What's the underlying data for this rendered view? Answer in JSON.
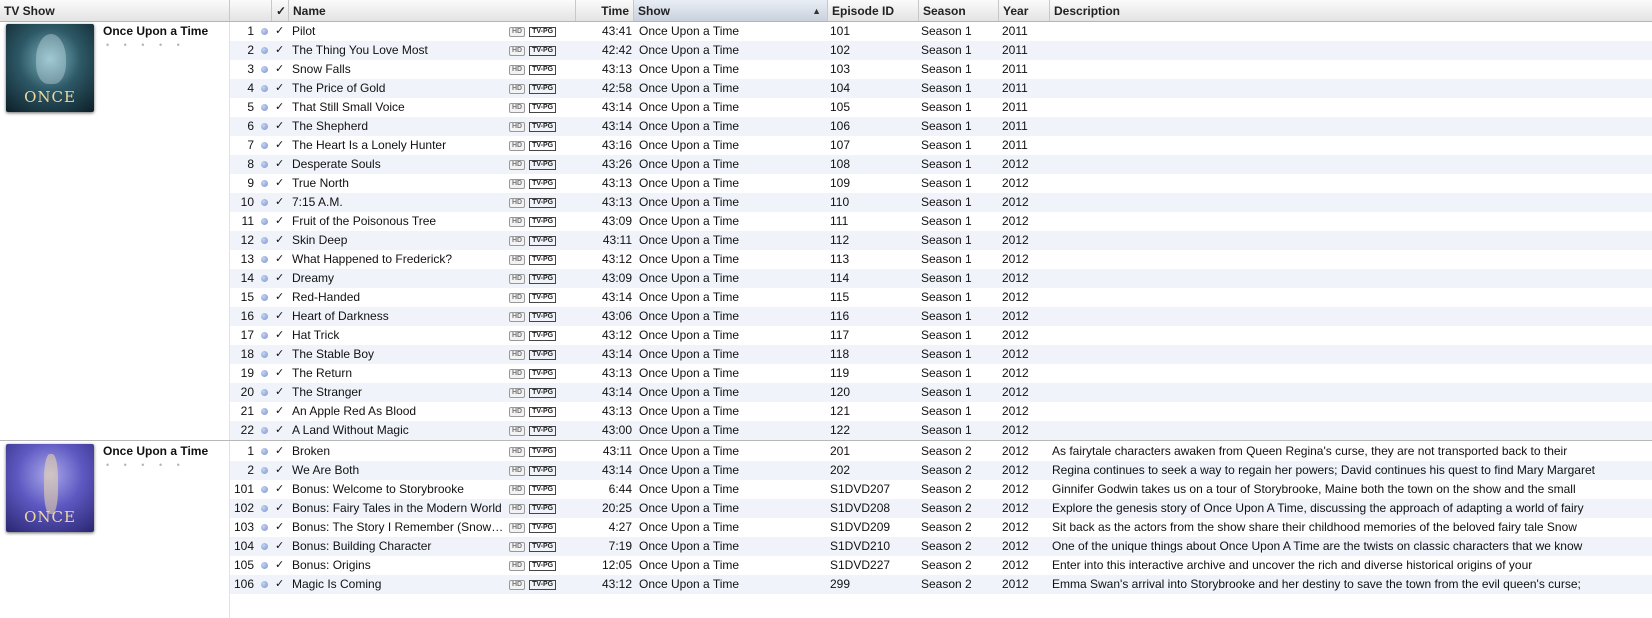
{
  "columns": {
    "tv_show": "TV Show",
    "check": "✓",
    "name": "Name",
    "time": "Time",
    "show": "Show",
    "episode_id": "Episode ID",
    "season": "Season",
    "year": "Year",
    "description": "Description"
  },
  "sort": {
    "column": "Show",
    "direction": "ascending",
    "icon": "sort-ascending-icon"
  },
  "groups": [
    {
      "title": "Once Upon a Time",
      "rating_dots": "• • • • •",
      "artwork_text": "ONCE",
      "rows": [
        {
          "num": "1",
          "name": "Pilot",
          "hd": "HD",
          "rating": "TV-PG",
          "time": "43:41",
          "show": "Once Upon a Time",
          "episode_id": "101",
          "season": "Season 1",
          "year": "2011",
          "description": ""
        },
        {
          "num": "2",
          "name": "The Thing You Love Most",
          "hd": "HD",
          "rating": "TV-PG",
          "time": "42:42",
          "show": "Once Upon a Time",
          "episode_id": "102",
          "season": "Season 1",
          "year": "2011",
          "description": ""
        },
        {
          "num": "3",
          "name": "Snow Falls",
          "hd": "HD",
          "rating": "TV-PG",
          "time": "43:13",
          "show": "Once Upon a Time",
          "episode_id": "103",
          "season": "Season 1",
          "year": "2011",
          "description": ""
        },
        {
          "num": "4",
          "name": "The Price of Gold",
          "hd": "HD",
          "rating": "TV-PG",
          "time": "42:58",
          "show": "Once Upon a Time",
          "episode_id": "104",
          "season": "Season 1",
          "year": "2011",
          "description": ""
        },
        {
          "num": "5",
          "name": "That Still Small Voice",
          "hd": "HD",
          "rating": "TV-PG",
          "time": "43:14",
          "show": "Once Upon a Time",
          "episode_id": "105",
          "season": "Season 1",
          "year": "2011",
          "description": ""
        },
        {
          "num": "6",
          "name": "The Shepherd",
          "hd": "HD",
          "rating": "TV-PG",
          "time": "43:14",
          "show": "Once Upon a Time",
          "episode_id": "106",
          "season": "Season 1",
          "year": "2011",
          "description": ""
        },
        {
          "num": "7",
          "name": "The Heart Is a Lonely Hunter",
          "hd": "HD",
          "rating": "TV-PG",
          "time": "43:16",
          "show": "Once Upon a Time",
          "episode_id": "107",
          "season": "Season 1",
          "year": "2011",
          "description": ""
        },
        {
          "num": "8",
          "name": "Desperate Souls",
          "hd": "HD",
          "rating": "TV-PG",
          "time": "43:26",
          "show": "Once Upon a Time",
          "episode_id": "108",
          "season": "Season 1",
          "year": "2012",
          "description": ""
        },
        {
          "num": "9",
          "name": "True North",
          "hd": "HD",
          "rating": "TV-PG",
          "time": "43:13",
          "show": "Once Upon a Time",
          "episode_id": "109",
          "season": "Season 1",
          "year": "2012",
          "description": ""
        },
        {
          "num": "10",
          "name": "7:15 A.M.",
          "hd": "HD",
          "rating": "TV-PG",
          "time": "43:13",
          "show": "Once Upon a Time",
          "episode_id": "110",
          "season": "Season 1",
          "year": "2012",
          "description": ""
        },
        {
          "num": "11",
          "name": "Fruit of the Poisonous Tree",
          "hd": "HD",
          "rating": "TV-PG",
          "time": "43:09",
          "show": "Once Upon a Time",
          "episode_id": "111",
          "season": "Season 1",
          "year": "2012",
          "description": ""
        },
        {
          "num": "12",
          "name": "Skin Deep",
          "hd": "HD",
          "rating": "TV-PG",
          "time": "43:11",
          "show": "Once Upon a Time",
          "episode_id": "112",
          "season": "Season 1",
          "year": "2012",
          "description": ""
        },
        {
          "num": "13",
          "name": "What Happened to Frederick?",
          "hd": "HD",
          "rating": "TV-PG",
          "time": "43:12",
          "show": "Once Upon a Time",
          "episode_id": "113",
          "season": "Season 1",
          "year": "2012",
          "description": ""
        },
        {
          "num": "14",
          "name": "Dreamy",
          "hd": "HD",
          "rating": "TV-PG",
          "time": "43:09",
          "show": "Once Upon a Time",
          "episode_id": "114",
          "season": "Season 1",
          "year": "2012",
          "description": ""
        },
        {
          "num": "15",
          "name": "Red-Handed",
          "hd": "HD",
          "rating": "TV-PG",
          "time": "43:14",
          "show": "Once Upon a Time",
          "episode_id": "115",
          "season": "Season 1",
          "year": "2012",
          "description": ""
        },
        {
          "num": "16",
          "name": "Heart of Darkness",
          "hd": "HD",
          "rating": "TV-PG",
          "time": "43:06",
          "show": "Once Upon a Time",
          "episode_id": "116",
          "season": "Season 1",
          "year": "2012",
          "description": ""
        },
        {
          "num": "17",
          "name": "Hat Trick",
          "hd": "HD",
          "rating": "TV-PG",
          "time": "43:12",
          "show": "Once Upon a Time",
          "episode_id": "117",
          "season": "Season 1",
          "year": "2012",
          "description": ""
        },
        {
          "num": "18",
          "name": "The Stable Boy",
          "hd": "HD",
          "rating": "TV-PG",
          "time": "43:14",
          "show": "Once Upon a Time",
          "episode_id": "118",
          "season": "Season 1",
          "year": "2012",
          "description": ""
        },
        {
          "num": "19",
          "name": "The Return",
          "hd": "HD",
          "rating": "TV-PG",
          "time": "43:13",
          "show": "Once Upon a Time",
          "episode_id": "119",
          "season": "Season 1",
          "year": "2012",
          "description": ""
        },
        {
          "num": "20",
          "name": "The Stranger",
          "hd": "HD",
          "rating": "TV-PG",
          "time": "43:14",
          "show": "Once Upon a Time",
          "episode_id": "120",
          "season": "Season 1",
          "year": "2012",
          "description": ""
        },
        {
          "num": "21",
          "name": "An Apple Red As Blood",
          "hd": "HD",
          "rating": "TV-PG",
          "time": "43:13",
          "show": "Once Upon a Time",
          "episode_id": "121",
          "season": "Season 1",
          "year": "2012",
          "description": ""
        },
        {
          "num": "22",
          "name": "A Land Without Magic",
          "hd": "HD",
          "rating": "TV-PG",
          "time": "43:00",
          "show": "Once Upon a Time",
          "episode_id": "122",
          "season": "Season 1",
          "year": "2012",
          "description": ""
        }
      ]
    },
    {
      "title": "Once Upon a Time",
      "rating_dots": "• • • • •",
      "artwork_text": "ONCE",
      "rows": [
        {
          "num": "1",
          "name": "Broken",
          "hd": "HD",
          "rating": "TV-PG",
          "time": "43:11",
          "show": "Once Upon a Time",
          "episode_id": "201",
          "season": "Season 2",
          "year": "2012",
          "description": "As fairytale characters awaken from Queen Regina's curse, they are not transported back to their"
        },
        {
          "num": "2",
          "name": "We Are Both",
          "hd": "HD",
          "rating": "TV-PG",
          "time": "43:14",
          "show": "Once Upon a Time",
          "episode_id": "202",
          "season": "Season 2",
          "year": "2012",
          "description": "Regina continues to seek a way to regain her powers; David continues his quest to find Mary Margaret"
        },
        {
          "num": "101",
          "name": "Bonus: Welcome to Storybrooke",
          "hd": "HD",
          "rating": "TV-PG",
          "time": "6:44",
          "show": "Once Upon a Time",
          "episode_id": "S1DVD207",
          "season": "Season 2",
          "year": "2012",
          "description": "Ginnifer Godwin takes us on a tour of Storybrooke, Maine both the town on the show and the small"
        },
        {
          "num": "102",
          "name": "Bonus: Fairy Tales in the Modern World",
          "hd": "HD",
          "rating": "TV-PG",
          "time": "20:25",
          "show": "Once Upon a Time",
          "episode_id": "S1DVD208",
          "season": "Season 2",
          "year": "2012",
          "description": "Explore the genesis story of Once Upon A Time, discussing the approach of adapting a world of fairy"
        },
        {
          "num": "103",
          "name": "Bonus: The Story I Remember (Snow…",
          "hd": "HD",
          "rating": "TV-PG",
          "time": "4:27",
          "show": "Once Upon a Time",
          "episode_id": "S1DVD209",
          "season": "Season 2",
          "year": "2012",
          "description": "Sit back as the actors from the show share their childhood memories of the beloved fairy tale Snow"
        },
        {
          "num": "104",
          "name": "Bonus: Building Character",
          "hd": "HD",
          "rating": "TV-PG",
          "time": "7:19",
          "show": "Once Upon a Time",
          "episode_id": "S1DVD210",
          "season": "Season 2",
          "year": "2012",
          "description": "One of the unique things about Once Upon A Time are the twists on classic characters that we know"
        },
        {
          "num": "105",
          "name": "Bonus: Origins",
          "hd": "HD",
          "rating": "TV-PG",
          "time": "12:05",
          "show": "Once Upon a Time",
          "episode_id": "S1DVD227",
          "season": "Season 2",
          "year": "2012",
          "description": "Enter into this interactive archive and uncover the rich and diverse historical origins of your"
        },
        {
          "num": "106",
          "name": "Magic Is Coming",
          "hd": "HD",
          "rating": "TV-PG",
          "time": "43:12",
          "show": "Once Upon a Time",
          "episode_id": "299",
          "season": "Season 2",
          "year": "2012",
          "description": "Emma Swan's arrival into Storybrooke and her destiny to save the town from the evil queen's curse;"
        }
      ]
    }
  ]
}
